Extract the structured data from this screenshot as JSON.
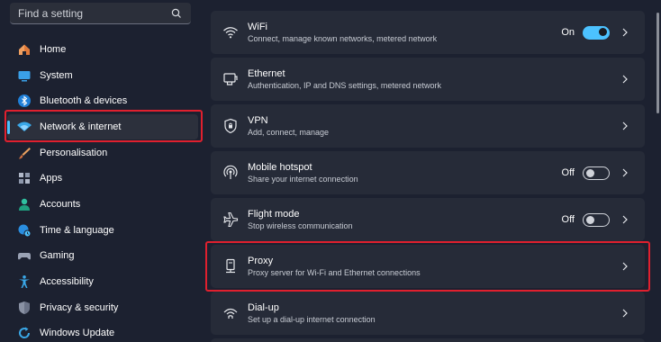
{
  "search": {
    "placeholder": "Find a setting"
  },
  "sidebar": {
    "items": [
      {
        "label": "Home",
        "icon": "home-icon"
      },
      {
        "label": "System",
        "icon": "system-icon"
      },
      {
        "label": "Bluetooth & devices",
        "icon": "bluetooth-icon"
      },
      {
        "label": "Network & internet",
        "icon": "network-icon",
        "selected": true
      },
      {
        "label": "Personalisation",
        "icon": "brush-icon"
      },
      {
        "label": "Apps",
        "icon": "apps-icon"
      },
      {
        "label": "Accounts",
        "icon": "accounts-icon"
      },
      {
        "label": "Time & language",
        "icon": "globe-clock-icon"
      },
      {
        "label": "Gaming",
        "icon": "gamepad-icon"
      },
      {
        "label": "Accessibility",
        "icon": "accessibility-icon"
      },
      {
        "label": "Privacy & security",
        "icon": "shield-icon"
      },
      {
        "label": "Windows Update",
        "icon": "windows-update-icon"
      }
    ]
  },
  "settings": [
    {
      "title": "WiFi",
      "subtitle": "Connect, manage known networks, metered network",
      "state": "On",
      "toggle": "on",
      "icon": "wifi-icon"
    },
    {
      "title": "Ethernet",
      "subtitle": "Authentication, IP and DNS settings, metered network",
      "icon": "ethernet-icon"
    },
    {
      "title": "VPN",
      "subtitle": "Add, connect, manage",
      "icon": "vpn-shield-icon"
    },
    {
      "title": "Mobile hotspot",
      "subtitle": "Share your internet connection",
      "state": "Off",
      "toggle": "off",
      "icon": "hotspot-icon"
    },
    {
      "title": "Flight mode",
      "subtitle": "Stop wireless communication",
      "state": "Off",
      "toggle": "off",
      "icon": "airplane-icon"
    },
    {
      "title": "Proxy",
      "subtitle": "Proxy server for Wi-Fi and Ethernet connections",
      "icon": "proxy-icon"
    },
    {
      "title": "Dial-up",
      "subtitle": "Set up a dial-up internet connection",
      "icon": "dialup-icon"
    }
  ],
  "colors": {
    "accent": "#4cc2ff",
    "highlight": "#e0202e",
    "background": "#1c2130",
    "card": "#262b38"
  }
}
